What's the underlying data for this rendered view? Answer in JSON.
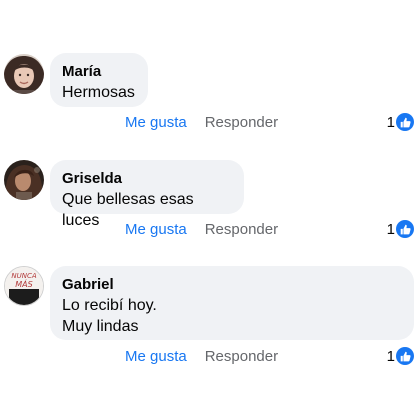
{
  "colors": {
    "bubble_bg": "#f0f2f5",
    "link_blue": "#1877f2",
    "muted_gray": "#65676b",
    "text": "#050505"
  },
  "comments": [
    {
      "author": "María",
      "lines": [
        "Hermosas"
      ],
      "like_label": "Me gusta",
      "reply_label": "Responder",
      "reaction_count": "1",
      "reaction_icon": "like-thumb-icon"
    },
    {
      "author": "Griselda",
      "lines": [
        "Que bellesas esas luces"
      ],
      "like_label": "Me gusta",
      "reply_label": "Responder",
      "reaction_count": "1",
      "reaction_icon": "like-thumb-icon"
    },
    {
      "author": "Gabriel",
      "lines": [
        "Lo recibí hoy.",
        "Muy lindas"
      ],
      "avatar_text": [
        "NUNCA",
        "MÁS"
      ],
      "like_label": "Me gusta",
      "reply_label": "Responder",
      "reaction_count": "1",
      "reaction_icon": "like-thumb-icon"
    }
  ]
}
